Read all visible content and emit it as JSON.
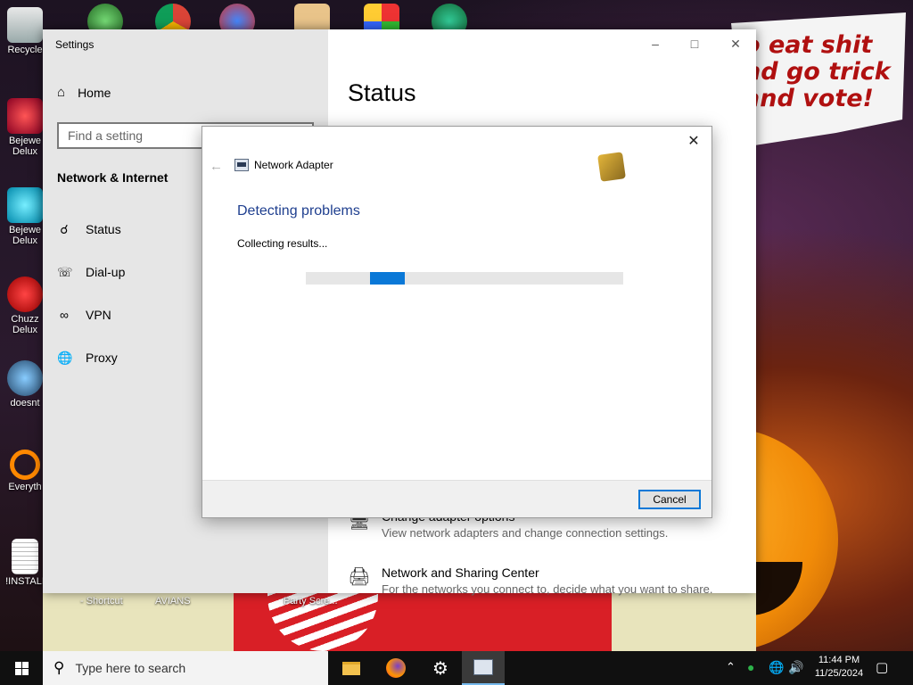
{
  "desktop": {
    "icons": [
      {
        "label": "Recycle"
      },
      {
        "label": "Bejewe\nDelux"
      },
      {
        "label": "Bejewe\nDelux"
      },
      {
        "label": "Chuzz\nDelux"
      },
      {
        "label": "doesnt"
      },
      {
        "label": "Everyth"
      },
      {
        "label": "!INSTALI"
      }
    ],
    "strip_labels": [
      "- Shortcut",
      "AVIANS",
      "Party Scre..."
    ],
    "banner_lines": [
      "o eat shit",
      "nd go trick",
      "and vote!"
    ]
  },
  "settings": {
    "title": "Settings",
    "home": "Home",
    "search_placeholder": "Find a setting",
    "section": "Network & Internet",
    "nav": [
      {
        "label": "Status",
        "icon": "globe-status-icon"
      },
      {
        "label": "Dial-up",
        "icon": "dialup-icon"
      },
      {
        "label": "VPN",
        "icon": "vpn-icon"
      },
      {
        "label": "Proxy",
        "icon": "globe-icon"
      }
    ],
    "page_title": "Status",
    "options": [
      {
        "title": "Change adapter options",
        "desc": "View network adapters and change connection settings."
      },
      {
        "title": "Network and Sharing Center",
        "desc": "For the networks you connect to, decide what you want to share."
      }
    ]
  },
  "dialog": {
    "title": "Network Adapter",
    "heading": "Detecting problems",
    "status": "Collecting results...",
    "progress_indeterminate": true,
    "cancel": "Cancel"
  },
  "taskbar": {
    "search_placeholder": "Type here to search",
    "time": "11:44 PM",
    "date": "11/25/2024"
  },
  "colors": {
    "accent": "#0a78d7",
    "heading_blue": "#1f3f8f",
    "banner_red": "#b01010"
  }
}
